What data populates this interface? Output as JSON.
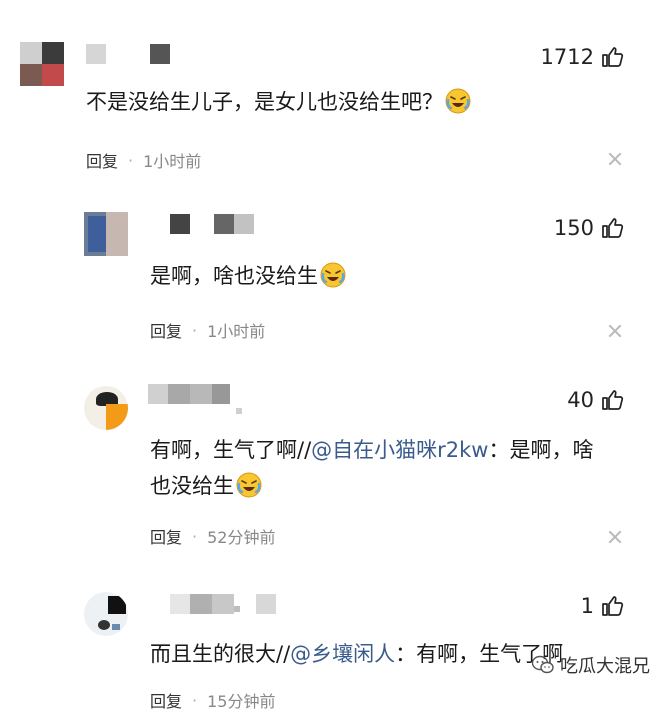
{
  "comments": [
    {
      "likes": "1712",
      "text": "不是没给生儿子，是女儿也没给生吧？",
      "reply_label": "回复",
      "time": "1小时前"
    },
    {
      "likes": "150",
      "text": "是啊，啥也没给生",
      "reply_label": "回复",
      "time": "1小时前"
    },
    {
      "likes": "40",
      "text_before": "有啊，生气了啊//",
      "mention": "@自在小猫咪r2kw",
      "text_after": "：是啊，啥",
      "text_line2": "也没给生",
      "reply_label": "回复",
      "time": "52分钟前"
    },
    {
      "likes": "1",
      "text_before": "而且生的很大//",
      "mention": "@乡壤闲人",
      "text_after": "：有啊，生气了啊",
      "reply_label": "回复",
      "time": "15分钟前"
    }
  ],
  "icons": {
    "like": "thumbs-up-icon",
    "close": "close-icon",
    "emoji": "crying-laughing-emoji-icon"
  },
  "watermark": {
    "text": "吃瓜大混兄"
  },
  "colors": {
    "mention": "#3a5b8c",
    "meta_time": "#888888"
  }
}
